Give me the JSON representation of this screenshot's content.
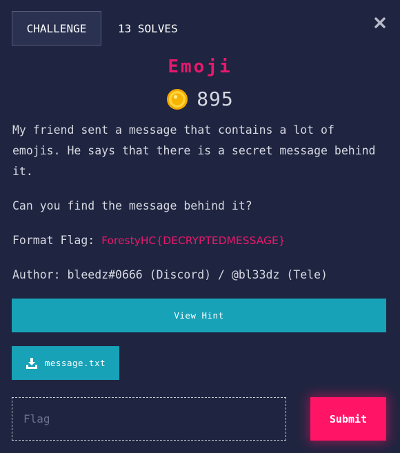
{
  "tabs": {
    "challenge_label": "CHALLENGE",
    "solves_label": "13 SOLVES"
  },
  "challenge": {
    "title": "Emoji",
    "points": "895",
    "description": [
      "My friend sent a message that contains a lot of emojis. He says that there is a secret message behind it.",
      "Can you find the message behind it?"
    ],
    "format_label": "Format Flag: ",
    "format_value": "ForestyHC{DECRYPTEDMESSAGE}",
    "author": "Author: bleedz#0666 (Discord) / @bl33dz (Tele)"
  },
  "actions": {
    "hint_label": "View Hint",
    "file_label": "message.txt",
    "flag_placeholder": "Flag",
    "submit_label": "Submit"
  },
  "icons": {
    "close": "close-icon",
    "coin": "coin-icon",
    "download": "download-icon"
  },
  "colors": {
    "background": "#1f2540",
    "accent_pink": "#e8196d",
    "button_teal": "#17a2b8",
    "submit_pink": "#ff1466"
  }
}
